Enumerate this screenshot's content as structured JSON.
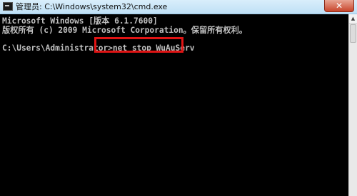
{
  "window": {
    "title": "管理员: C:\\Windows\\system32\\cmd.exe",
    "close_label": "✕"
  },
  "console": {
    "lines": [
      "Microsoft Windows [版本 6.1.7600]",
      "版权所有 (c) 2009 Microsoft Corporation。保留所有权利。"
    ],
    "prompt": "C:\\Users\\Administrator>",
    "command": "net stop WuAuServ"
  },
  "scrollbar": {
    "up_arrow": "▲"
  },
  "colors": {
    "console_bg": "#000000",
    "console_text": "#c0c0c0",
    "highlight": "#e01414",
    "titlebar": "#bfe0f5"
  },
  "icons": [
    "cmd-app-icon",
    "close-icon",
    "scroll-up-icon"
  ]
}
